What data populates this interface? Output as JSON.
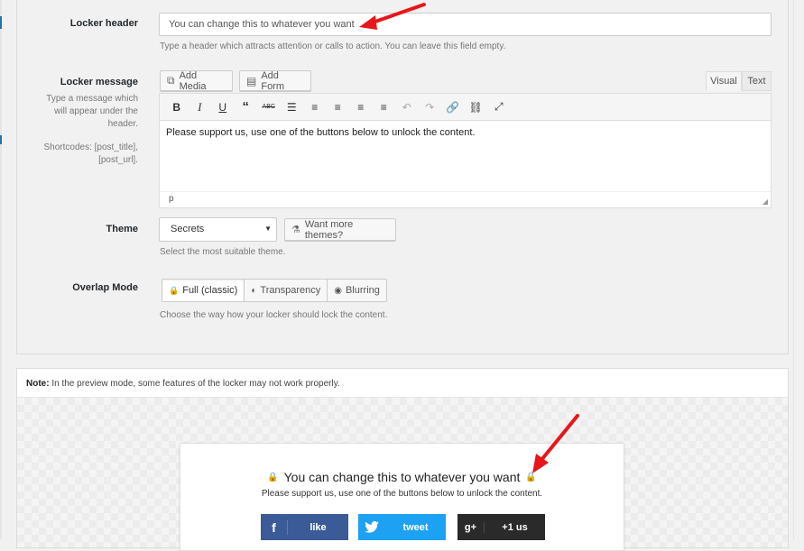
{
  "settings": {
    "locker_header": {
      "label": "Locker header",
      "value": "You can change this to whatever you want",
      "hint": "Type a header which attracts attention or calls to action. You can leave this field empty."
    },
    "locker_message": {
      "label": "Locker message",
      "hint_lines": [
        "Type a message which",
        "will appear under the",
        "header."
      ],
      "shortcodes_lines": [
        "Shortcodes: [post_title],",
        "[post_url]."
      ],
      "add_media_label": "Add Media",
      "add_form_label": "Add Form",
      "tab_visual": "Visual",
      "tab_text": "Text",
      "toolbar": [
        "bold-icon",
        "italic-icon",
        "underline-icon",
        "blockquote-icon",
        "strikethrough-icon",
        "bullet-list-icon",
        "numbered-list-icon",
        "align-left-icon",
        "align-center-icon",
        "align-right-icon",
        "undo-icon",
        "redo-icon",
        "link-icon",
        "unlink-icon",
        "fullscreen-icon"
      ],
      "content": "Please support us, use one of the buttons below to unlock the content.",
      "status_path": "p"
    },
    "theme": {
      "label": "Theme",
      "selected": "Secrets",
      "more_themes_label": "Want more themes?",
      "hint": "Select the most suitable theme."
    },
    "overlap_mode": {
      "label": "Overlap Mode",
      "options": [
        "Full (classic)",
        "Transparency",
        "Blurring"
      ],
      "active": "Full (classic)",
      "hint": "Choose the way how your locker should lock the content."
    }
  },
  "preview": {
    "note_bold": "Note:",
    "note_text": " In the preview mode, some features of the locker may not work properly.",
    "locker_title": "You can change this to whatever you want",
    "locker_message": "Please support us, use one of the buttons below to unlock the content.",
    "buttons": [
      {
        "icon": "facebook-icon",
        "glyph": "f",
        "label": "like",
        "color": "#3b5b98"
      },
      {
        "icon": "twitter-icon",
        "glyph": "🐦",
        "label": "tweet",
        "color": "#1da1f2"
      },
      {
        "icon": "google-plus-icon",
        "glyph": "g+",
        "label": "+1 us",
        "color": "#2a2a2a"
      }
    ]
  },
  "colors": {
    "annotation_arrow": "#e8161a"
  }
}
